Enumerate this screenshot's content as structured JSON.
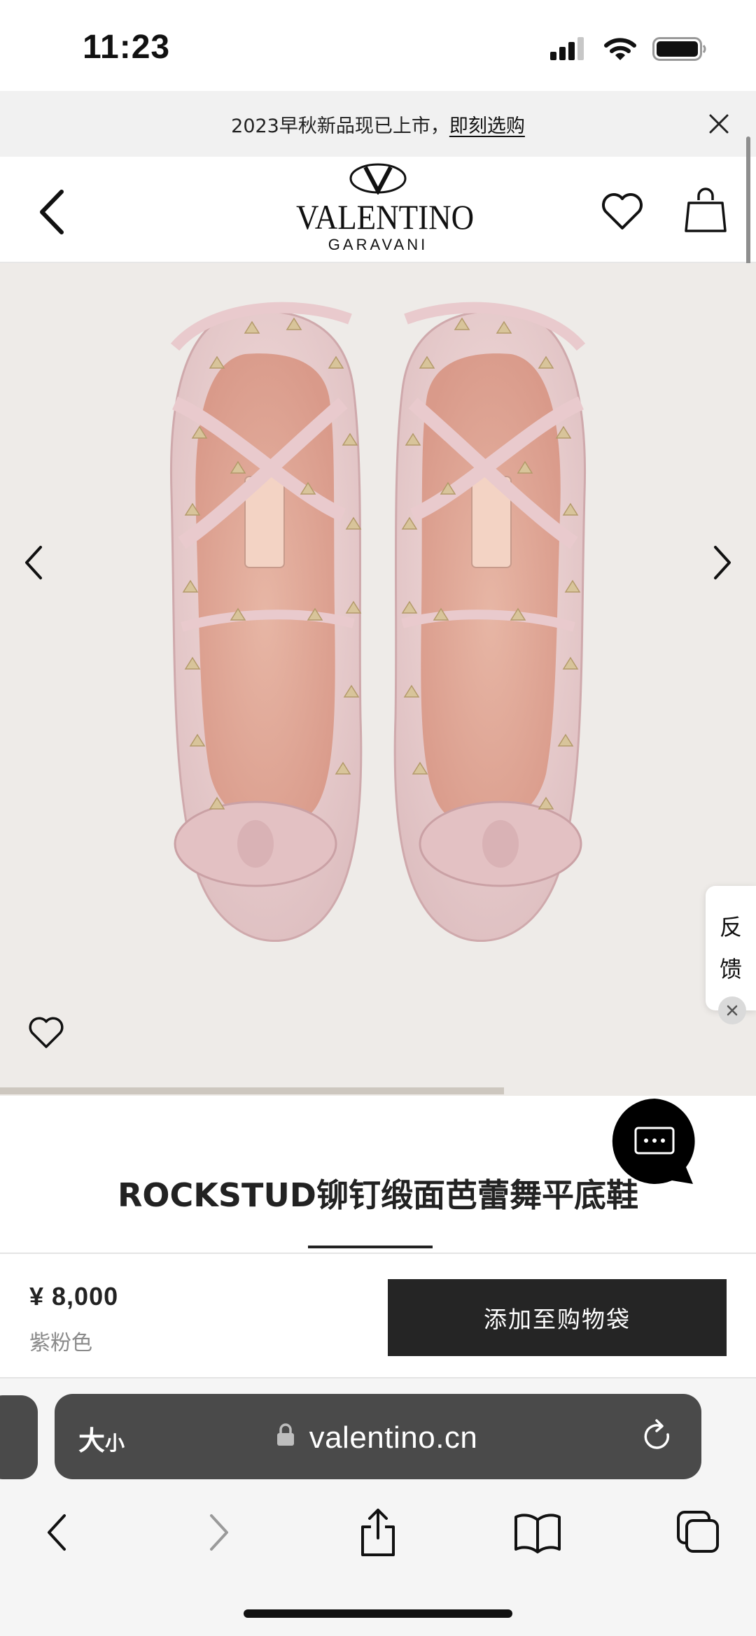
{
  "status_bar": {
    "time": "11:23"
  },
  "promo": {
    "text": "2023早秋新品现已上市，",
    "link": "即刻选购"
  },
  "header": {
    "brand": "VALENTINO",
    "brand_sub": "GARAVANI"
  },
  "product": {
    "title": "ROCKSTUD铆钉缎面芭蕾舞平底鞋",
    "price": "¥ 8,000",
    "color": "紫粉色",
    "image_progress": 0.667
  },
  "feedback": {
    "line1": "反",
    "line2": "馈"
  },
  "cta": {
    "add_to_bag": "添加至购物袋"
  },
  "browser": {
    "text_size": "大",
    "text_size_small": "小",
    "url": "valentino.cn"
  },
  "colors": {
    "cta_bg": "#252525",
    "gallery_bg": "#eeebe8",
    "url_bar_bg": "#4a4a4a"
  }
}
